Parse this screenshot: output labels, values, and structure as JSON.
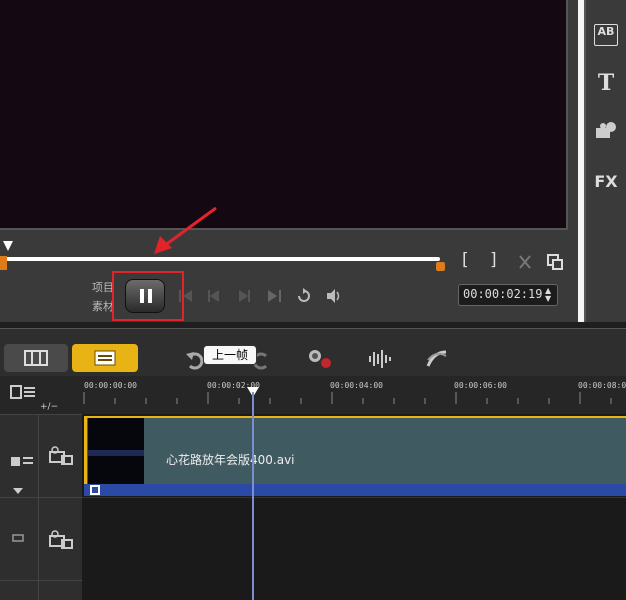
{
  "preview": {
    "mode_project": "项目",
    "mode_clip": "素材",
    "timecode": "00:00:02:19",
    "mark_in": "[",
    "mark_out": "]"
  },
  "sidebar_tools": [
    {
      "label": "AB",
      "icon": "transition-icon"
    },
    {
      "label": "T",
      "icon": "title-icon"
    },
    {
      "label": "",
      "icon": "graphics-icon"
    },
    {
      "label": "FX",
      "icon": "filter-icon"
    }
  ],
  "tooltip": "上一帧",
  "ruler_ticks": [
    "00:00:00:00",
    "00:00:02:00",
    "00:00:04:00",
    "00:00:06:00",
    "00:00:08:00"
  ],
  "timeline": {
    "add_remove": "+/−",
    "clip_name": "心花路放年会版400.avi"
  },
  "colors": {
    "accent_yellow": "#e8b314",
    "highlight_red": "#e0242a",
    "scrub_orange": "#e07b1a",
    "clip_teal": "#3f5a60",
    "clip_bar_blue": "#2a4aa6"
  }
}
